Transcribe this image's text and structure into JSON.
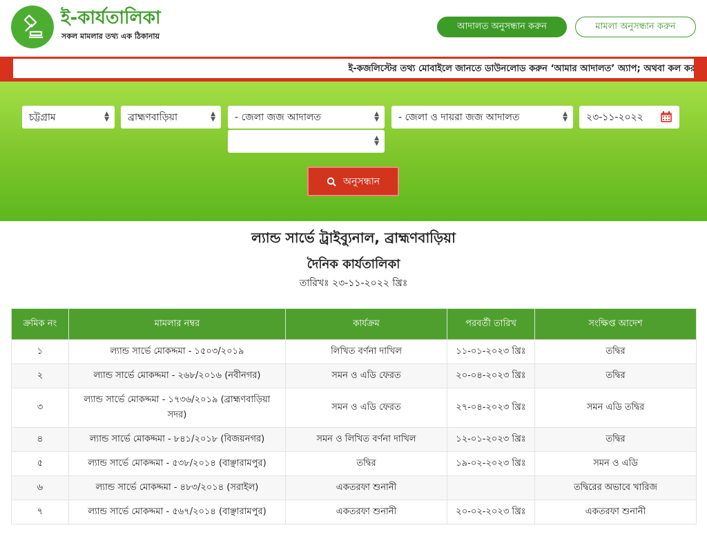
{
  "header": {
    "logo_title": "ই-কার্যতালিকা",
    "logo_subtitle": "সকল মামলার তথ্য এক ঠিকানায়",
    "court_search_btn": "আদালত অনুসন্ধান করুন",
    "case_search_btn": "মামলা অনুসন্ধান করুন"
  },
  "ticker": {
    "text": "ই-কজলিস্টের তথ্য মোবাইলে জানতে ডাউনলোড করুন ‘আমার আদালত’ অ্যাপ; অথবা কল কর"
  },
  "filters": {
    "division": "চট্টগ্রাম",
    "district": "ব্রাহ্মণবাড়িয়া",
    "court_type": "- জেলা জজ আদালত",
    "court_sub_type": "- জেলা ও দায়রা জজ আদালত",
    "date": "২৩-১১-২০২২",
    "court": "",
    "search_label": "অনুসন্ধান"
  },
  "colors": {
    "brand_green": "#4cae31",
    "accent_red": "#d2341e"
  },
  "report": {
    "court_name": "ল্যান্ড সার্ভে ট্রাইব্যুনাল, ব্রাহ্মণবাড়িয়া",
    "list_title": "দৈনিক কার্যতালিকা",
    "date_line": "তারিখঃ ২৩-১১-২০২২ খ্রিঃ"
  },
  "table": {
    "headers": [
      "ক্রমিক নং",
      "মামলার নম্বর",
      "কার্যক্রম",
      "পরবর্তী তারিখ",
      "সংক্ষিপ্ত আদেশ"
    ],
    "rows": [
      {
        "serial": "১",
        "case_no": "ল্যান্ড সার্ভে মোকদ্দমা - ১৫০৩/২০১৯",
        "activity": "লিখিত বর্ণনা দাখিল",
        "next_date": "১১-০১-২০২৩ খ্রিঃ",
        "order": "তদ্বির",
        "order_red": false
      },
      {
        "serial": "২",
        "case_no": "ল্যান্ড সার্ভে মোকদ্দমা - ২৬৮/২০১৬ (নবীনগর)",
        "activity": "সমন ও এডি ফেরত",
        "next_date": "২০-০৪-২০২৩ খ্রিঃ",
        "order": "তদ্বির",
        "order_red": false
      },
      {
        "serial": "৩",
        "case_no": "ল্যান্ড সার্ভে মোকদ্দমা - ১৭৩৬/২০১৯ (ব্রাহ্মণবাড়িয়া সদর)",
        "activity": "সমন ও এডি ফেরত",
        "next_date": "২৭-০৪-২০২৩ খ্রিঃ",
        "order": "সমন এডি তদ্বির",
        "order_red": false
      },
      {
        "serial": "৪",
        "case_no": "ল্যান্ড সার্ভে মোকদ্দমা - ৮৪১/২০১৮ (বিজয়নগর)",
        "activity": "সমন ও লিখিত বর্ণনা দাখিল",
        "next_date": "১২-০১-২০২৩ খ্রিঃ",
        "order": "তদ্বির",
        "order_red": false
      },
      {
        "serial": "৫",
        "case_no": "ল্যান্ড সার্ভে মোকদ্দমা - ৫৩৮/২০১৪ (বাঞ্ছারামপুর)",
        "activity": "তদ্বির",
        "next_date": "১৯-০২-২০২৩ খ্রিঃ",
        "order": "সমন ও এডি",
        "order_red": false
      },
      {
        "serial": "৬",
        "case_no": "ল্যান্ড সার্ভে মোকদ্দমা - ৪৮৩/২০১৪ (সরাইল)",
        "activity": "একতরফা শুনানী",
        "next_date": "",
        "order": "তদ্বিরের অভাবে খারিজ",
        "order_red": true
      },
      {
        "serial": "৭",
        "case_no": "ল্যান্ড সার্ভে মোকদ্দমা - ৫৬৭/২০১৪ (বাঞ্ছারামপুর)",
        "activity": "একতরফা শুনানী",
        "next_date": "২০-০২-২০২৩ খ্রিঃ",
        "order": "একতরফা শুনানী",
        "order_red": false
      }
    ]
  }
}
